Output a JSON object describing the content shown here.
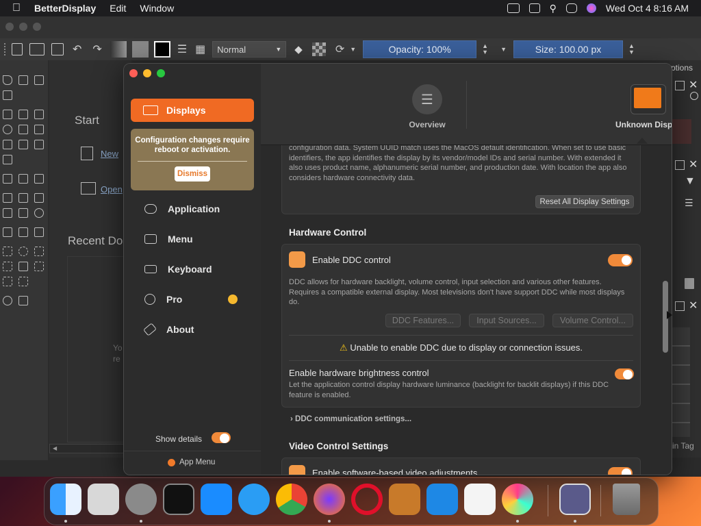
{
  "menubar": {
    "app": "BetterDisplay",
    "items": [
      "Edit",
      "Window"
    ],
    "clock": "Wed Oct 4  8:16 AM"
  },
  "editor": {
    "blend_mode": "Normal",
    "opacity": "Opacity: 100%",
    "size": "Size: 100.00 px",
    "start_heading": "Start",
    "new_label": "New",
    "open_label": "Open",
    "recent_heading": "Recent Do",
    "recent_hint_1": "Yo",
    "recent_hint_2": "re",
    "right_tab": "ptions",
    "tag_label": "in Tag"
  },
  "sidebar": {
    "active": "Displays",
    "notice": "Configuration changes require reboot or activation.",
    "dismiss": "Dismiss",
    "items": [
      "Application",
      "Menu",
      "Keyboard",
      "Pro",
      "About"
    ],
    "show_details": "Show details",
    "app_menu": "App Menu"
  },
  "header": {
    "tabs": [
      {
        "label": "Overview"
      },
      {
        "label": "Unknown Display"
      }
    ]
  },
  "identification": {
    "text": "configuration data. System UUID match uses the MacOS default identification. When set to use basic identifiers, the app identifies the display by its vendor/model IDs and serial number. With extended it also uses product name, alphanumeric serial number, and production date. With location the app also considers hardware connectivity data.",
    "reset_button": "Reset All Display Settings"
  },
  "hardware": {
    "title": "Hardware Control",
    "ddc_label": "Enable DDC control",
    "ddc_desc": "DDC allows for hardware backlight, volume control, input selection and various other features. Requires a compatible external display. Most televisions don't have support DDC while most displays do.",
    "buttons": [
      "DDC Features...",
      "Input Sources...",
      "Volume Control..."
    ],
    "warning": "Unable to enable DDC due to display or connection issues.",
    "brightness_label": "Enable hardware brightness control",
    "brightness_desc": "Let the application control display hardware luminance (backlight for backlit displays) if this DDC feature is enabled.",
    "comm_settings": "DDC communication settings..."
  },
  "video": {
    "title": "Video Control Settings",
    "first_item": "Enable software-based video adjustments"
  },
  "colors": {
    "accent": "#f06a23",
    "notice_bg": "#8a7753"
  }
}
